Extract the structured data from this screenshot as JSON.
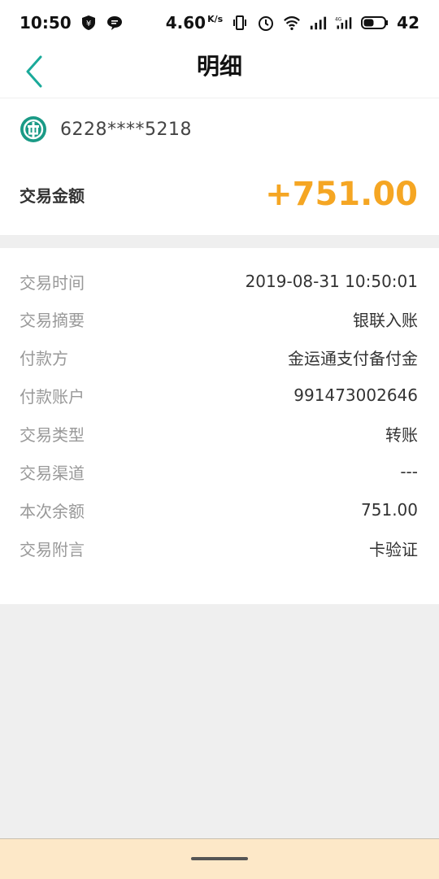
{
  "status": {
    "time": "10:50",
    "speed": "4.60",
    "speed_unit": "K/s",
    "battery": "42"
  },
  "header": {
    "title": "明细"
  },
  "account": {
    "number": "6228****5218"
  },
  "amount": {
    "label": "交易金额",
    "value": "+751.00",
    "color": "#f5a623"
  },
  "details": [
    {
      "label": "交易时间",
      "value": "2019-08-31 10:50:01"
    },
    {
      "label": "交易摘要",
      "value": "银联入账"
    },
    {
      "label": "付款方",
      "value": "金运通支付备付金"
    },
    {
      "label": "付款账户",
      "value": "991473002646"
    },
    {
      "label": "交易类型",
      "value": "转账"
    },
    {
      "label": "交易渠道",
      "value": "---"
    },
    {
      "label": "本次余额",
      "value": "751.00"
    },
    {
      "label": "交易附言",
      "value": "卡验证"
    }
  ],
  "icons": {
    "back": "chevron-left-icon",
    "bank": "abc-bank-logo-icon"
  },
  "colors": {
    "accent": "#1aaa9a",
    "amount": "#f5a623"
  }
}
